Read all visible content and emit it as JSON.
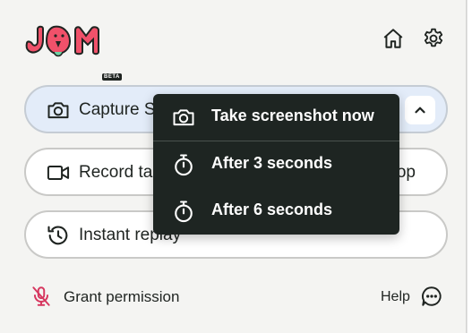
{
  "app": {
    "logo_text": "JAM",
    "logo_badge": "BETA",
    "brand_color": "#f0516a"
  },
  "header": {
    "home_icon": "home-icon",
    "settings_icon": "gear-icon"
  },
  "actions": {
    "capture": {
      "label": "Capture S",
      "icon": "camera-icon"
    },
    "record": {
      "label": "Record ta",
      "label_tail": "op",
      "icon": "video-camera-icon"
    },
    "replay": {
      "label": "Instant replay",
      "icon": "history-icon"
    }
  },
  "capture_menu": {
    "items": [
      {
        "label": "Take screenshot now",
        "icon": "camera-icon"
      },
      {
        "label": "After 3 seconds",
        "icon": "timer-icon"
      },
      {
        "label": "After 6 seconds",
        "icon": "timer-icon"
      }
    ],
    "background": "#1e2522"
  },
  "footer": {
    "permission_label": "Grant permission",
    "permission_icon": "microphone-off-icon",
    "permission_color": "#d6365f",
    "help_label": "Help",
    "help_icon": "chat-bubble-icon"
  }
}
